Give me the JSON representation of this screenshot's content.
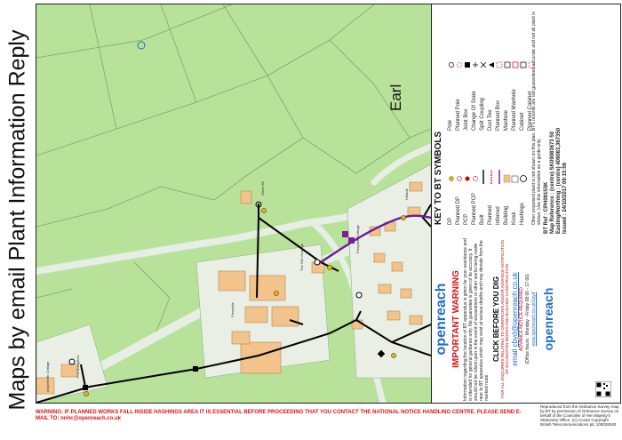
{
  "page_title": "Maps by email Plant Information Reply",
  "map": {
    "place_label": "Earl",
    "small_labels": [
      "Farrydale",
      "The Old Vicarage",
      "Farrydale Cottage",
      "Ampleforth Cottage",
      "Fox Bungalow",
      "West Hill",
      "Hillside"
    ],
    "colors": {
      "field": "#b8e29a",
      "road": "#e7eee5",
      "building": "#f2c48c",
      "building_grey": "#d9d9d9",
      "route": "#000000",
      "route_purple": "#6a1b9a",
      "marker_yellow": "#e8b400",
      "parcel_line": "#7aa86a"
    }
  },
  "legend": {
    "key_title": "KEY TO BT SYMBOLS",
    "symbols_left": [
      {
        "label": "Pole",
        "icon": "circle-icon"
      },
      {
        "label": "Planned Pole",
        "icon": "dashed-circle-icon"
      },
      {
        "label": "Joint Box",
        "icon": "filled-square-icon"
      },
      {
        "label": "Change Of State",
        "icon": "plus-icon"
      },
      {
        "label": "Split Coupling",
        "icon": "x-icon"
      },
      {
        "label": "Duct Tee",
        "icon": "triangle-icon"
      },
      {
        "label": "Planned Box",
        "icon": "dashed-square-icon"
      },
      {
        "label": "Manhole",
        "icon": "manhole-icon"
      },
      {
        "label": "Planned Manhole",
        "icon": "planned-manhole-icon"
      },
      {
        "label": "Cabinet",
        "icon": "cabinet-icon"
      },
      {
        "label": "Planned Cabinet",
        "icon": "planned-cabinet-icon"
      }
    ],
    "symbols_right": [
      {
        "label": "DP",
        "icon": "dp-icon"
      },
      {
        "label": "Planned DP",
        "icon": "planned-dp-icon"
      },
      {
        "label": "PCP",
        "icon": "pcp-icon"
      },
      {
        "label": "Planned PCP",
        "icon": "planned-pcp-icon"
      },
      {
        "label": "Built",
        "icon": "built-line-icon"
      },
      {
        "label": "Planned",
        "icon": "planned-line-icon"
      },
      {
        "label": "Inferred",
        "icon": "inferred-line-icon"
      },
      {
        "label": "Building",
        "icon": "building-icon"
      },
      {
        "label": "Kiosk",
        "icon": "kiosk-icon"
      },
      {
        "label": "Hashings",
        "icon": "hashing-icon"
      }
    ],
    "note": "Other proposed plant is not shown on this plan. BT's records are not guaranteed accurate and not all plant is shown. Use this information as a guide only.",
    "ref": {
      "bt_ref": "BT Ref : CPH09153K",
      "map_reference": "Map Reference : (centre) SK09083673 50",
      "easting_northing": "Easting/Northing : (centre) 409083,367350",
      "issued": "Issued : 24/10/2017 09:15:56"
    },
    "warning_title": "IMPORTANT WARNING",
    "warning_text": "Information regarding the location of BT apparatus is given for your assistance and is intended for general guidance only. No guarantee is given of its accuracy. It should not be relied upon in the event of excavations or other works being made near to BT apparatus which may exist at various depths and may deviate from the marked route.",
    "click_before": "CLICK BEFORE YOU DIG",
    "click_sub": "FOR ALL ENQUIRIES RELATING TO DIVERSIONS AND/OR ADVANCE NOTIFICATION OF EXCAVATION WORKS AND BUILDING CONSTRUCTION",
    "email_label": "email",
    "email_addr": "cbyd@openreach.co.uk",
    "advance_notice": "ADVANCE NOTICE REQUIRED",
    "office_hours": "(Office hours : Monday - Friday 08:00 - 17:00)",
    "website": "www.openreach.co.uk/cbyd",
    "brand": "openreach",
    "copyright": "Reproduced from the Ordnance Survey map by BT by permission of Ordnance Survey on behalf of the Controller of Her Majesty's Stationery Office. (C) Crown Copyright British Telecommunications plc 100028040",
    "bottom_warning": "WARNING: IF PLANNED WORKS FALL INSIDE HASHINGS AREA IT IS ESSENTIAL BEFORE PROCEEDING THAT YOU CONTACT THE NATIONAL NOTICE HANDLING CENTRE. PLEASE SEND E-MAIL TO: nnhc@openreach.co.uk"
  }
}
